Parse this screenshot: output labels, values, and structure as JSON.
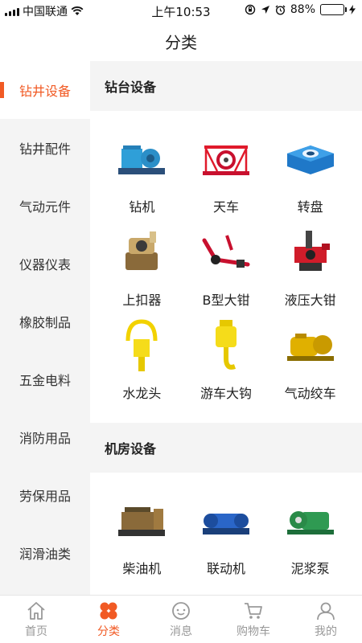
{
  "status_bar": {
    "carrier": "中国联通",
    "time": "上午10:53",
    "battery": "88%",
    "battery_level": 0.88
  },
  "header": {
    "title": "分类"
  },
  "sidebar": {
    "items": [
      {
        "label": "钻井设备",
        "active": true
      },
      {
        "label": "钻井配件"
      },
      {
        "label": "气动元件"
      },
      {
        "label": "仪器仪表"
      },
      {
        "label": "橡胶制品"
      },
      {
        "label": "五金电料"
      },
      {
        "label": "消防用品"
      },
      {
        "label": "劳保用品"
      },
      {
        "label": "润滑油类"
      }
    ]
  },
  "sections": [
    {
      "title": "钻台设备",
      "items": [
        {
          "label": "钻机",
          "icon": "drilling-rig-icon"
        },
        {
          "label": "天车",
          "icon": "crown-block-icon"
        },
        {
          "label": "转盘",
          "icon": "rotary-table-icon"
        },
        {
          "label": "上扣器",
          "icon": "spinner-icon"
        },
        {
          "label": "B型大钳",
          "icon": "b-type-tong-icon"
        },
        {
          "label": "液压大钳",
          "icon": "hydraulic-tong-icon"
        },
        {
          "label": "水龙头",
          "icon": "swivel-icon"
        },
        {
          "label": "游车大钩",
          "icon": "traveling-hook-icon"
        },
        {
          "label": "气动绞车",
          "icon": "air-winch-icon"
        }
      ]
    },
    {
      "title": "机房设备",
      "items": [
        {
          "label": "柴油机",
          "icon": "diesel-engine-icon"
        },
        {
          "label": "联动机",
          "icon": "compound-drive-icon"
        },
        {
          "label": "泥浆泵",
          "icon": "mud-pump-icon"
        }
      ]
    }
  ],
  "tabs": [
    {
      "label": "首页",
      "icon": "home-icon"
    },
    {
      "label": "分类",
      "icon": "category-icon",
      "active": true
    },
    {
      "label": "消息",
      "icon": "message-icon"
    },
    {
      "label": "购物车",
      "icon": "cart-icon"
    },
    {
      "label": "我的",
      "icon": "profile-icon"
    }
  ],
  "colors": {
    "accent": "#f15a24",
    "background": "#f4f4f4",
    "inactive": "#999999"
  }
}
